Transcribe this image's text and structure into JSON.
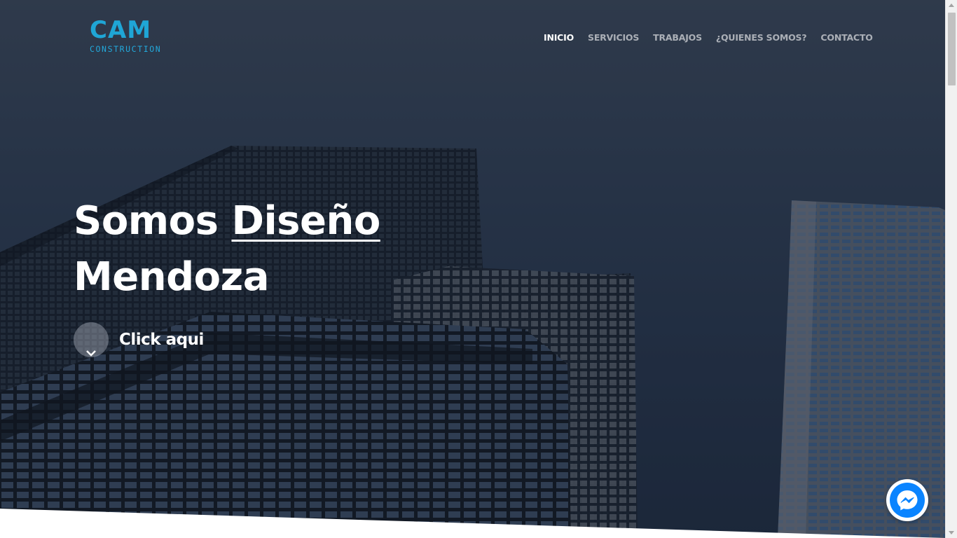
{
  "brand": {
    "logo_main": "CAM",
    "logo_sub": "CONSTRUCTION",
    "accent_color": "#1fa6d6"
  },
  "nav": {
    "items": [
      {
        "label": "INICIO",
        "active": true
      },
      {
        "label": "SERVICIOS",
        "active": false
      },
      {
        "label": "TRABAJOS",
        "active": false
      },
      {
        "label": "¿QUIENES SOMOS?",
        "active": false
      },
      {
        "label": "CONTACTO",
        "active": false
      }
    ]
  },
  "hero": {
    "headline_prefix": "Somos ",
    "headline_highlight": "Diseño",
    "headline_line2": "Mendoza",
    "cta_label": "Click aqui",
    "cta_icon": "chevron-down-icon"
  },
  "widgets": {
    "chat_icon": "messenger-icon",
    "chat_color": "#0a84ff"
  }
}
